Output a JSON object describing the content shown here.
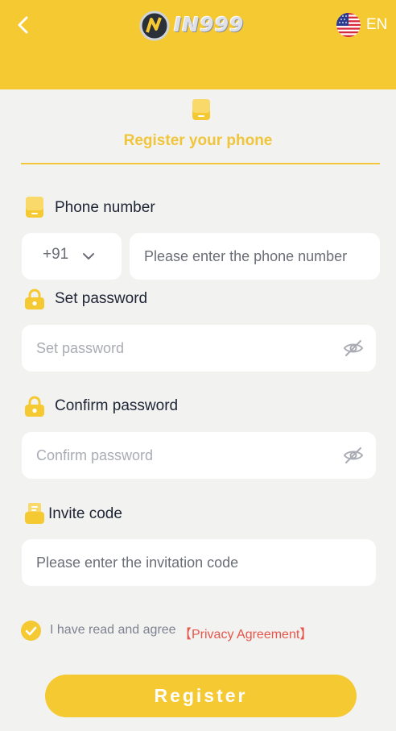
{
  "header": {
    "brand": "IN999",
    "language": "EN",
    "back_icon": "chevron-left-icon",
    "flag_icon": "us-flag-icon"
  },
  "page": {
    "title": "Register your phone",
    "title_icon": "phone-icon"
  },
  "phone": {
    "label": "Phone number",
    "country_code": "+91",
    "placeholder": "Please enter the phone number"
  },
  "password": {
    "label": "Set password",
    "placeholder": "Set password"
  },
  "confirm": {
    "label": "Confirm password",
    "placeholder": "Confirm password"
  },
  "invite": {
    "label": "Invite code",
    "placeholder": "Please enter the invitation code"
  },
  "agreement": {
    "text": "I have read and agree",
    "link": "【Privacy Agreement】",
    "checked": true
  },
  "register": {
    "label": "Register"
  },
  "colors": {
    "accent": "#f5c932",
    "link": "#e8554a",
    "background": "#f2f2f1"
  }
}
